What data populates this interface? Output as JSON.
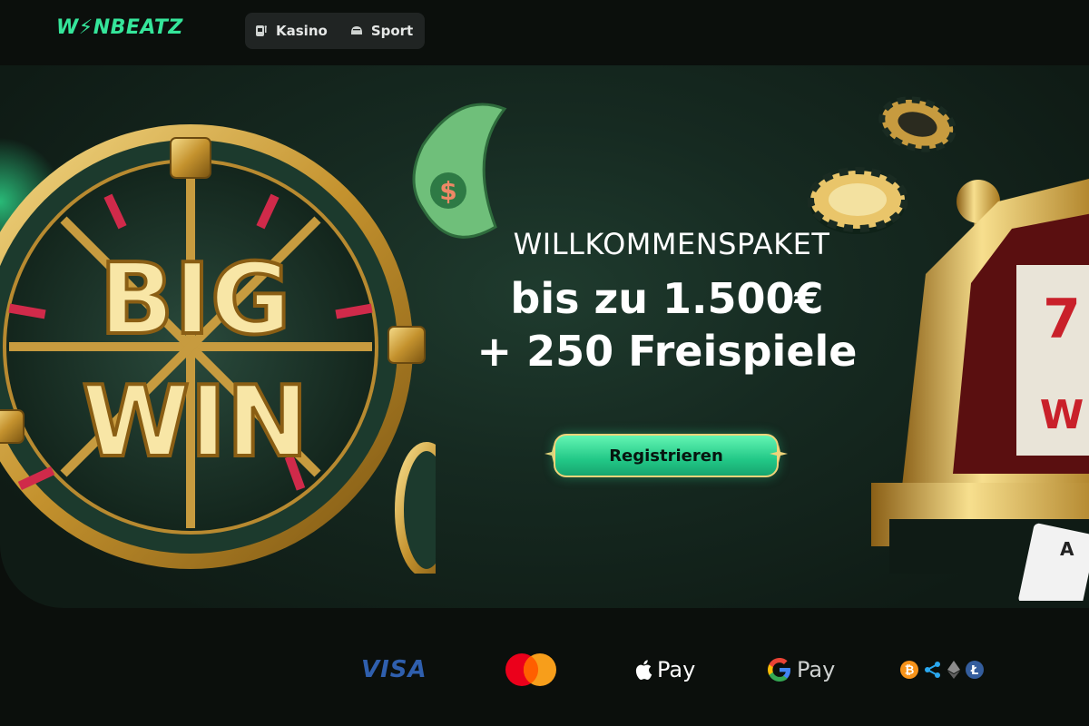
{
  "header": {
    "logo": "W⚡NBEATZ",
    "nav": [
      {
        "label": "Kasino",
        "icon": "slot-machine-icon"
      },
      {
        "label": "Sport",
        "icon": "helmet-icon"
      }
    ]
  },
  "hero": {
    "title": "WILLKOMMENSPAKET",
    "offer_line1": "bis zu 1.500€",
    "offer_line2": "+ 250 Freispiele",
    "cta_label": "Registrieren",
    "wheel_text_1": "BIG",
    "wheel_text_2": "WIN"
  },
  "payments": {
    "visa": "VISA",
    "apple_pay": "Pay",
    "google_pay": "Pay",
    "crypto_icons": [
      "bitcoin-icon",
      "ripple-icon",
      "ethereum-icon",
      "litecoin-icon"
    ]
  },
  "colors": {
    "brand": "#35e59a",
    "cta_gradient_top": "#63f5b3",
    "cta_gradient_bottom": "#17a56f",
    "gold": "#f0d37a",
    "background": "#0b0f0c"
  }
}
